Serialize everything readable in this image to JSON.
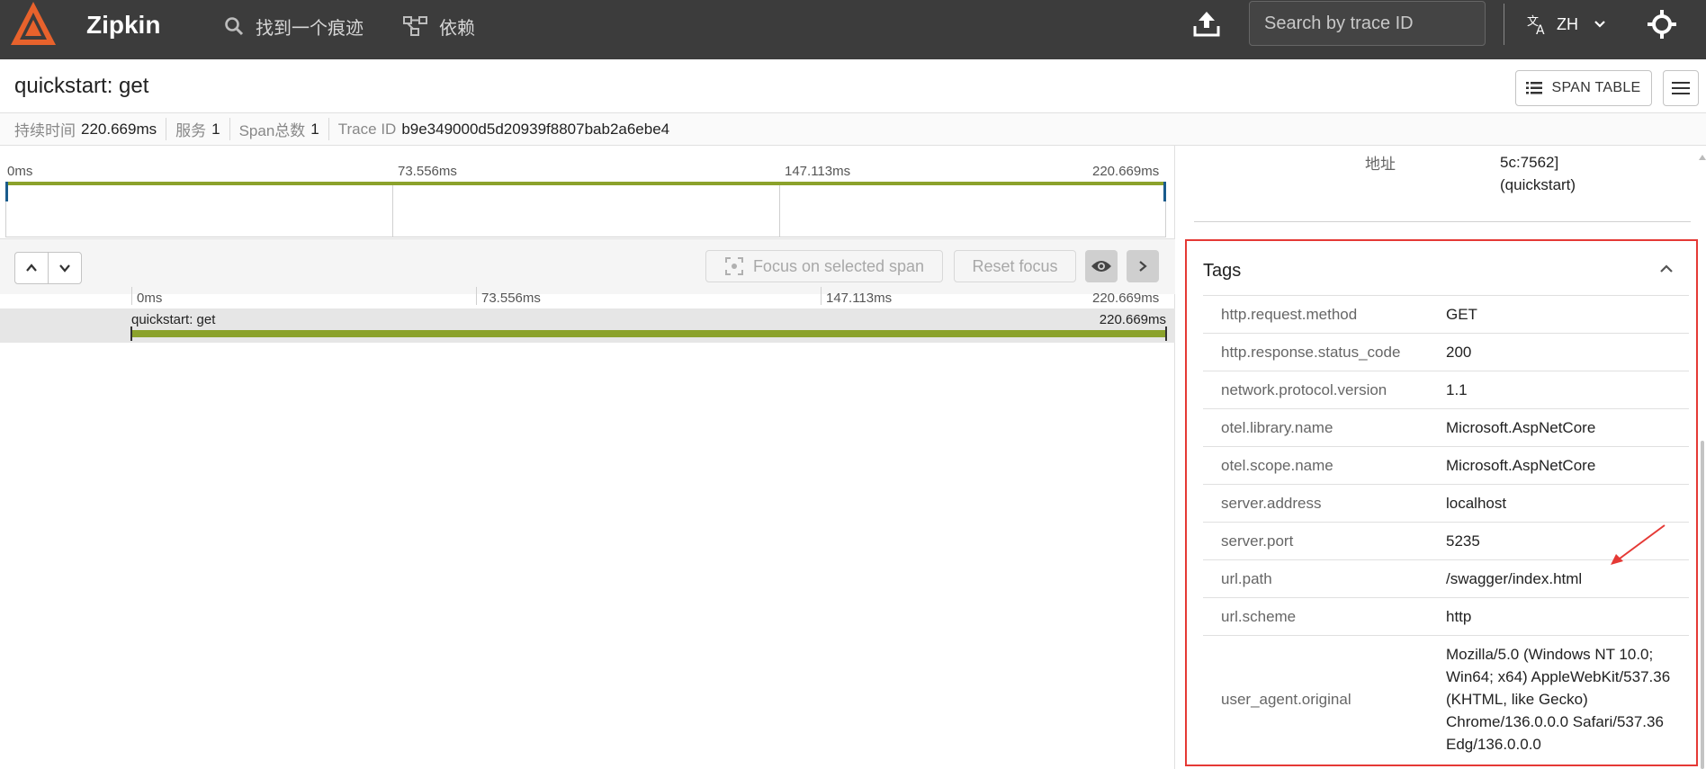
{
  "topbar": {
    "brand": "Zipkin",
    "nav_find": "找到一个痕迹",
    "nav_deps": "依赖",
    "search_placeholder": "Search by trace ID",
    "lang": "ZH"
  },
  "header": {
    "title": "quickstart: get",
    "span_table_label": "SPAN TABLE"
  },
  "summary": {
    "duration_label": "持续时间",
    "duration_value": "220.669ms",
    "services_label": "服务",
    "services_value": "1",
    "spans_label": "Span总数",
    "spans_value": "1",
    "traceid_label": "Trace ID",
    "traceid_value": "b9e349000d5d20939f8807bab2a6ebe4"
  },
  "minimap": {
    "ticks": [
      "0ms",
      "73.556ms",
      "147.113ms",
      "220.669ms"
    ]
  },
  "toolbar": {
    "focus_label": "Focus on selected span",
    "reset_label": "Reset focus"
  },
  "timeline": {
    "ticks": [
      "0ms",
      "73.556ms",
      "147.113ms",
      "220.669ms"
    ],
    "span_name": "quickstart: get",
    "span_duration": "220.669ms",
    "span_fraction": 1.0
  },
  "detail": {
    "address_label": "地址",
    "address_line1": "5c:7562]",
    "address_line2": "(quickstart)",
    "tags_title": "Tags",
    "tags": [
      {
        "key": "http.request.method",
        "value": "GET"
      },
      {
        "key": "http.response.status_code",
        "value": "200"
      },
      {
        "key": "network.protocol.version",
        "value": "1.1"
      },
      {
        "key": "otel.library.name",
        "value": "Microsoft.AspNetCore"
      },
      {
        "key": "otel.scope.name",
        "value": "Microsoft.AspNetCore"
      },
      {
        "key": "server.address",
        "value": "localhost"
      },
      {
        "key": "server.port",
        "value": "5235"
      },
      {
        "key": "url.path",
        "value": "/swagger/index.html"
      },
      {
        "key": "url.scheme",
        "value": "http"
      },
      {
        "key": "user_agent.original",
        "value": "Mozilla/5.0 (Windows NT 10.0; Win64; x64) AppleWebKit/537.36 (KHTML, like Gecko) Chrome/136.0.0.0 Safari/537.36 Edg/136.0.0.0"
      }
    ]
  },
  "colors": {
    "topbar": "#3c3c3c",
    "accent_orange": "#e8622c",
    "span_bar": "#8ba22b",
    "highlight": "#e53935"
  }
}
